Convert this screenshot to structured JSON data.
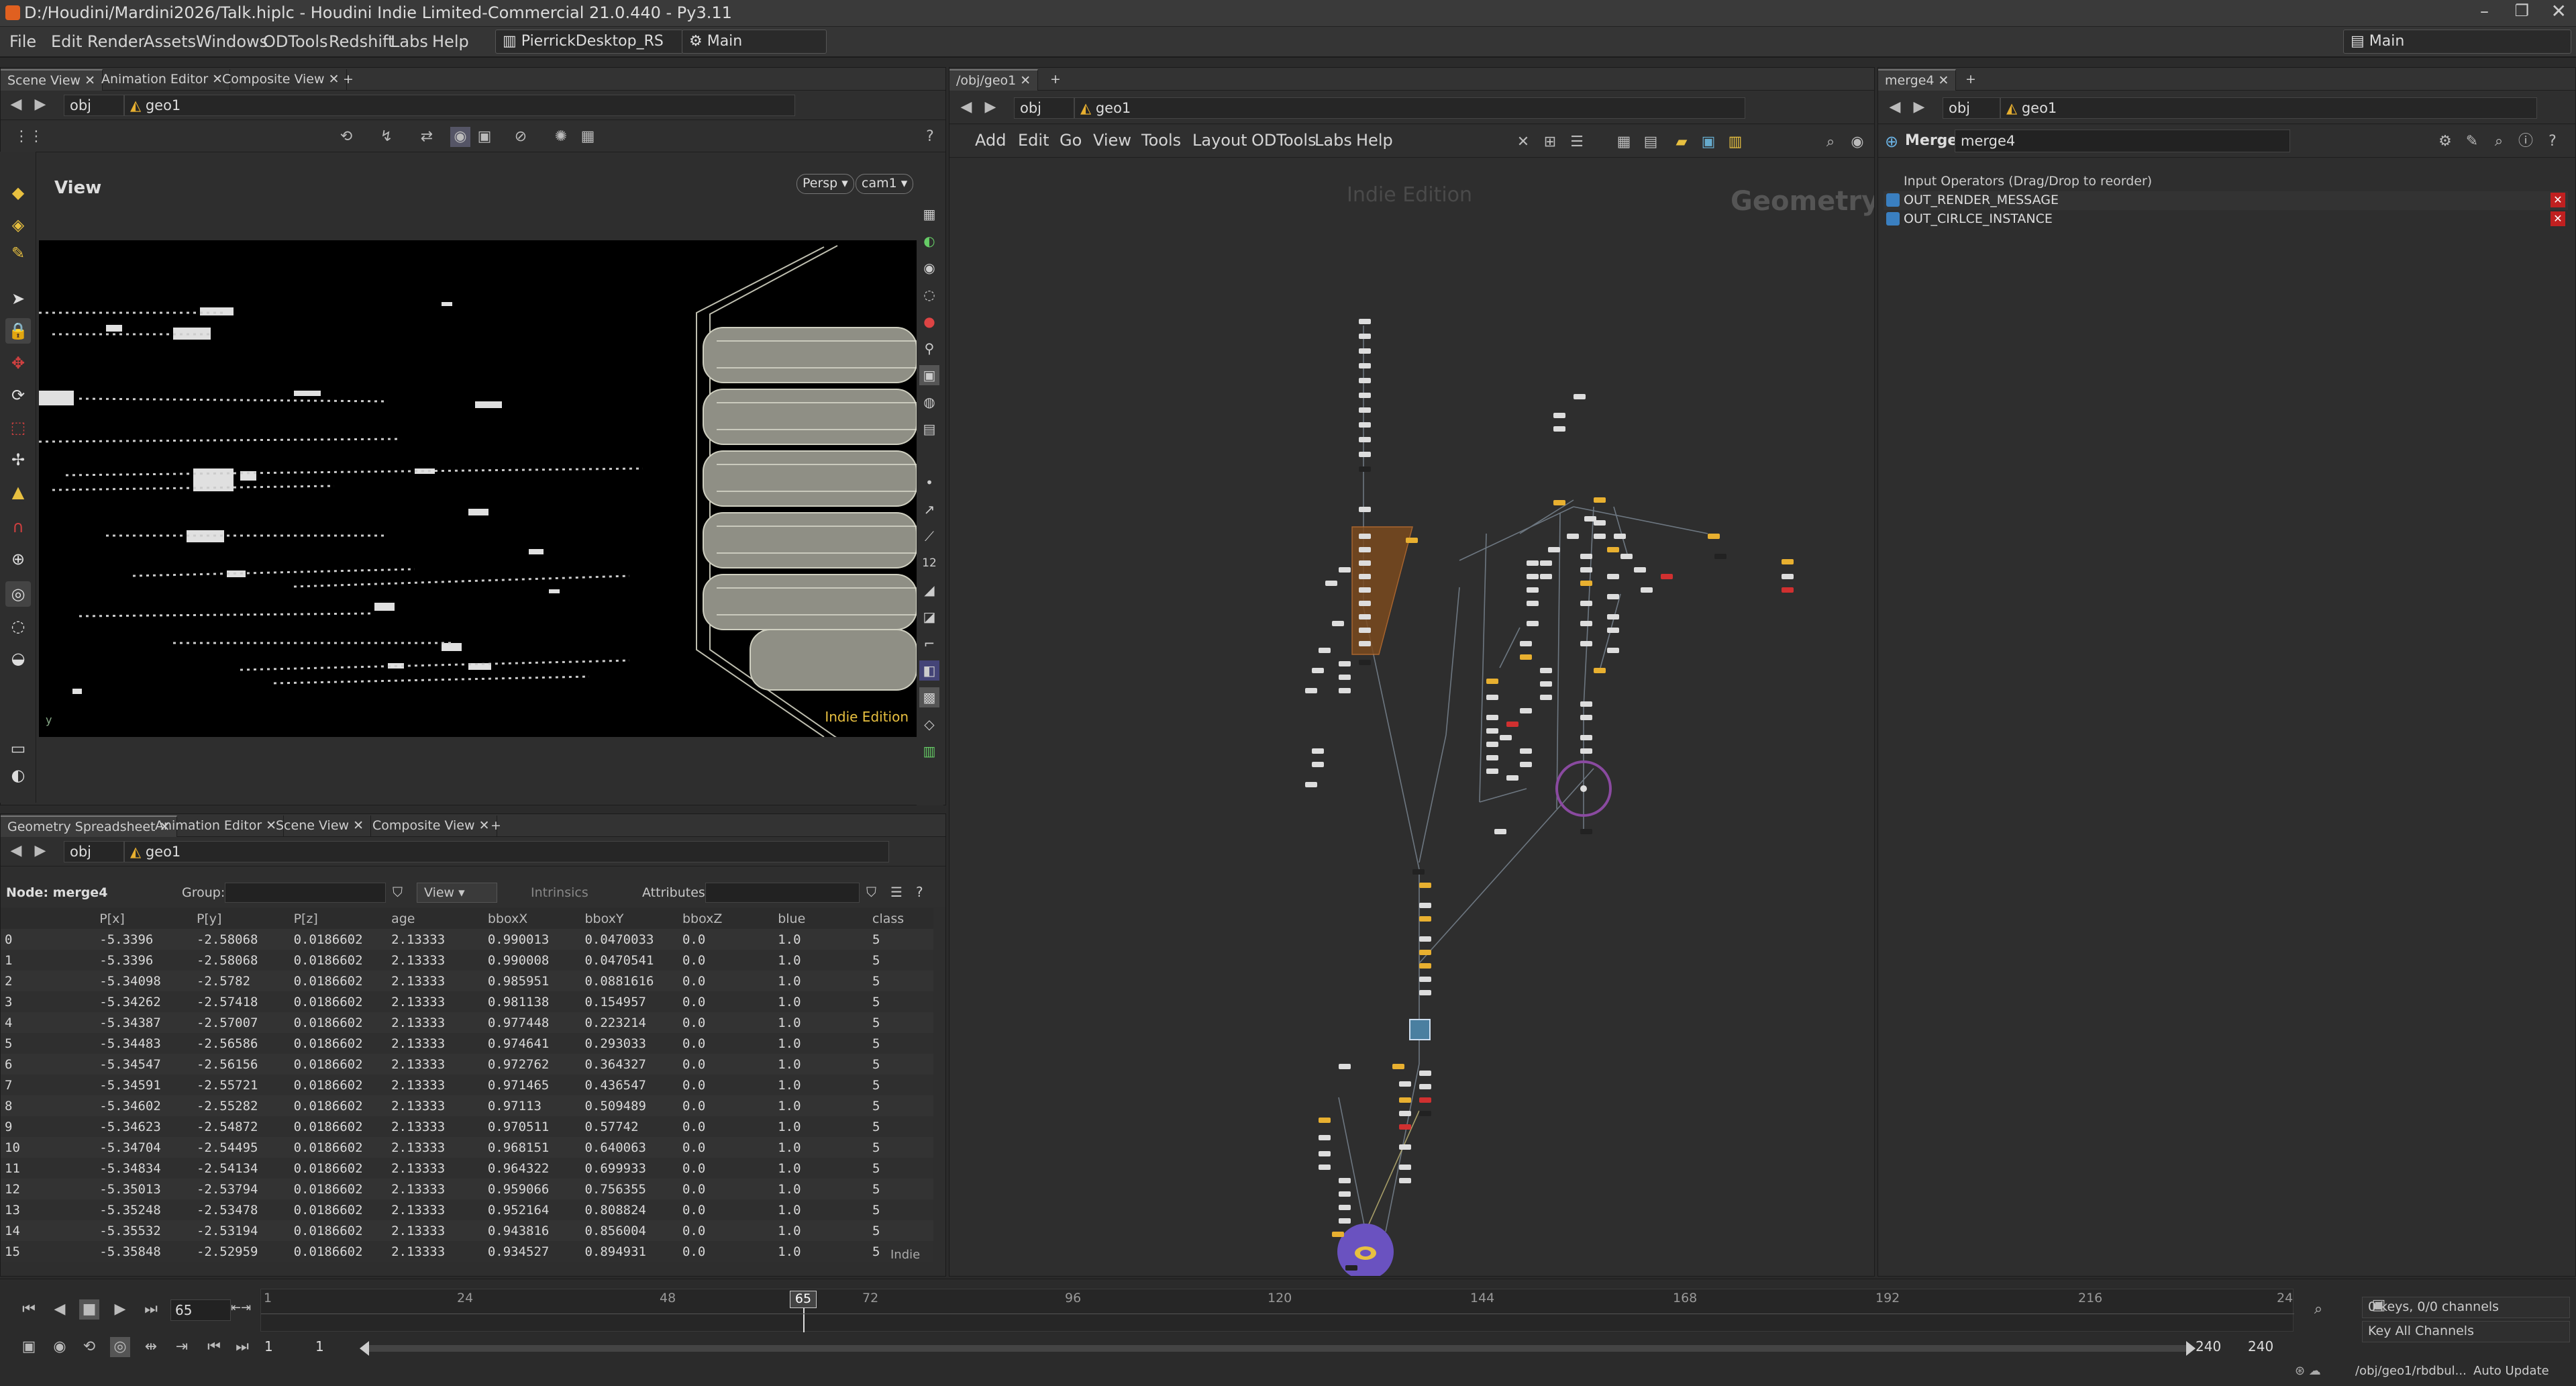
{
  "window": {
    "title": "D:/Houdini/Mardini2026/Talk.hiplc - Houdini Indie Limited-Commercial 21.0.440 - Py3.11"
  },
  "menu": {
    "items": [
      "File",
      "Edit",
      "Render",
      "Assets",
      "Windows",
      "ODTools",
      "Redshift",
      "Labs",
      "Help"
    ],
    "desktop": "PierrickDesktop_RS",
    "context": "Main",
    "right_context": "Main"
  },
  "scene_panel": {
    "tabs": [
      "Scene View",
      "Animation Editor",
      "Composite View"
    ],
    "path": {
      "root": "obj",
      "node": "geo1"
    },
    "view_label": "View",
    "persp": "Persp",
    "camera": "cam1",
    "watermark": "Indie Edition"
  },
  "spreadsheet": {
    "tabs": [
      "Geometry Spreadsheet",
      "Animation Editor",
      "Scene View",
      "Composite View"
    ],
    "path": {
      "root": "obj",
      "node": "geo1"
    },
    "node_label": "Node: merge4",
    "group_label": "Group:",
    "view_label": "View",
    "intrinsics_label": "Intrinsics",
    "attributes_label": "Attributes:",
    "columns": [
      "",
      "P[x]",
      "P[y]",
      "P[z]",
      "age",
      "bboxX",
      "bboxY",
      "bboxZ",
      "blue",
      "class"
    ],
    "rows": [
      [
        "0",
        "-5.3396",
        "-2.58068",
        "0.0186602",
        "2.13333",
        "0.990013",
        "0.0470033",
        "0.0",
        "1.0",
        "5"
      ],
      [
        "1",
        "-5.3396",
        "-2.58068",
        "0.0186602",
        "2.13333",
        "0.990008",
        "0.0470541",
        "0.0",
        "1.0",
        "5"
      ],
      [
        "2",
        "-5.34098",
        "-2.5782",
        "0.0186602",
        "2.13333",
        "0.985951",
        "0.0881616",
        "0.0",
        "1.0",
        "5"
      ],
      [
        "3",
        "-5.34262",
        "-2.57418",
        "0.0186602",
        "2.13333",
        "0.981138",
        "0.154957",
        "0.0",
        "1.0",
        "5"
      ],
      [
        "4",
        "-5.34387",
        "-2.57007",
        "0.0186602",
        "2.13333",
        "0.977448",
        "0.223214",
        "0.0",
        "1.0",
        "5"
      ],
      [
        "5",
        "-5.34483",
        "-2.56586",
        "0.0186602",
        "2.13333",
        "0.974641",
        "0.293033",
        "0.0",
        "1.0",
        "5"
      ],
      [
        "6",
        "-5.34547",
        "-2.56156",
        "0.0186602",
        "2.13333",
        "0.972762",
        "0.364327",
        "0.0",
        "1.0",
        "5"
      ],
      [
        "7",
        "-5.34591",
        "-2.55721",
        "0.0186602",
        "2.13333",
        "0.971465",
        "0.436547",
        "0.0",
        "1.0",
        "5"
      ],
      [
        "8",
        "-5.34602",
        "-2.55282",
        "0.0186602",
        "2.13333",
        "0.97113",
        "0.509489",
        "0.0",
        "1.0",
        "5"
      ],
      [
        "9",
        "-5.34623",
        "-2.54872",
        "0.0186602",
        "2.13333",
        "0.970511",
        "0.57742",
        "0.0",
        "1.0",
        "5"
      ],
      [
        "10",
        "-5.34704",
        "-2.54495",
        "0.0186602",
        "2.13333",
        "0.968151",
        "0.640063",
        "0.0",
        "1.0",
        "5"
      ],
      [
        "11",
        "-5.34834",
        "-2.54134",
        "0.0186602",
        "2.13333",
        "0.964322",
        "0.699933",
        "0.0",
        "1.0",
        "5"
      ],
      [
        "12",
        "-5.35013",
        "-2.53794",
        "0.0186602",
        "2.13333",
        "0.959066",
        "0.756355",
        "0.0",
        "1.0",
        "5"
      ],
      [
        "13",
        "-5.35248",
        "-2.53478",
        "0.0186602",
        "2.13333",
        "0.952164",
        "0.808824",
        "0.0",
        "1.0",
        "5"
      ],
      [
        "14",
        "-5.35532",
        "-2.53194",
        "0.0186602",
        "2.13333",
        "0.943816",
        "0.856004",
        "0.0",
        "1.0",
        "5"
      ],
      [
        "15",
        "-5.35848",
        "-2.52959",
        "0.0186602",
        "2.13333",
        "0.934527",
        "0.894931",
        "0.0",
        "1.0",
        "5"
      ]
    ],
    "watermark": "Indie"
  },
  "network": {
    "tab": "/obj/geo1",
    "path": {
      "root": "obj",
      "node": "geo1"
    },
    "menu": [
      "Add",
      "Edit",
      "Go",
      "View",
      "Tools",
      "Layout",
      "ODTools",
      "Labs",
      "Help"
    ],
    "watermark": "Indie Edition",
    "context_label": "Geometry"
  },
  "params": {
    "tab": "merge4",
    "path": {
      "root": "obj",
      "node": "geo1"
    },
    "node_type": "Merge",
    "node_name": "merge4",
    "section": "Input Operators (Drag/Drop to reorder)",
    "inputs": [
      "OUT_RENDER_MESSAGE",
      "OUT_CIRLCE_INSTANCE"
    ]
  },
  "timeline": {
    "current_frame": "65",
    "ticks": [
      "1",
      "24",
      "48",
      "65",
      "72",
      "96",
      "120",
      "144",
      "168",
      "192",
      "216",
      "24"
    ],
    "start": "1",
    "start2": "1",
    "end": "240",
    "end2": "240",
    "keys_label": "0 keys, 0/0 channels",
    "key_all": "Key All Channels",
    "status_path": "/obj/geo1/rbdbul...",
    "auto_update": "Auto Update"
  },
  "colors": {
    "accent": "#e8b030",
    "selected": "#9a5fd0",
    "node": "#dddddd",
    "error": "#d03030"
  }
}
